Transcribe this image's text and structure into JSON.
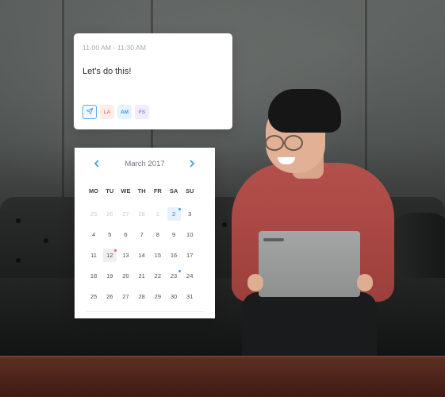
{
  "event": {
    "time": "11:00 AM - 11:30 AM",
    "title": "Let's do this!",
    "share_icon": "paper-plane-icon",
    "attendees": [
      "LA",
      "AM",
      "FS"
    ],
    "colors": {
      "la": "#f07e62",
      "am": "#3a9bf0",
      "fs": "#9b7fd9",
      "accent": "#55a6f3"
    }
  },
  "calendar": {
    "month": "March 2017",
    "prev_icon": "chevron-left-icon",
    "next_icon": "chevron-right-icon",
    "weekdays": [
      "MO",
      "TU",
      "WE",
      "TH",
      "FR",
      "SA",
      "SU"
    ],
    "days": [
      {
        "n": "25",
        "muted": true
      },
      {
        "n": "26",
        "muted": true
      },
      {
        "n": "27",
        "muted": true
      },
      {
        "n": "28",
        "muted": true
      },
      {
        "n": "1",
        "muted": true
      },
      {
        "n": "2",
        "selected": true,
        "dot": "blue"
      },
      {
        "n": "3"
      },
      {
        "n": "4"
      },
      {
        "n": "5"
      },
      {
        "n": "6"
      },
      {
        "n": "7"
      },
      {
        "n": "8"
      },
      {
        "n": "9"
      },
      {
        "n": "10"
      },
      {
        "n": "11"
      },
      {
        "n": "12",
        "today": true,
        "dot": "red"
      },
      {
        "n": "13"
      },
      {
        "n": "14"
      },
      {
        "n": "15"
      },
      {
        "n": "16"
      },
      {
        "n": "17"
      },
      {
        "n": "18"
      },
      {
        "n": "19"
      },
      {
        "n": "20"
      },
      {
        "n": "21"
      },
      {
        "n": "22"
      },
      {
        "n": "23",
        "dot": "blue"
      },
      {
        "n": "24"
      },
      {
        "n": "25"
      },
      {
        "n": "26"
      },
      {
        "n": "27"
      },
      {
        "n": "28"
      },
      {
        "n": "29"
      },
      {
        "n": "30"
      },
      {
        "n": "31"
      }
    ],
    "colors": {
      "accent": "#3a7bd5",
      "dot_blue": "#3a9bf0",
      "dot_red": "#f0674e"
    }
  }
}
